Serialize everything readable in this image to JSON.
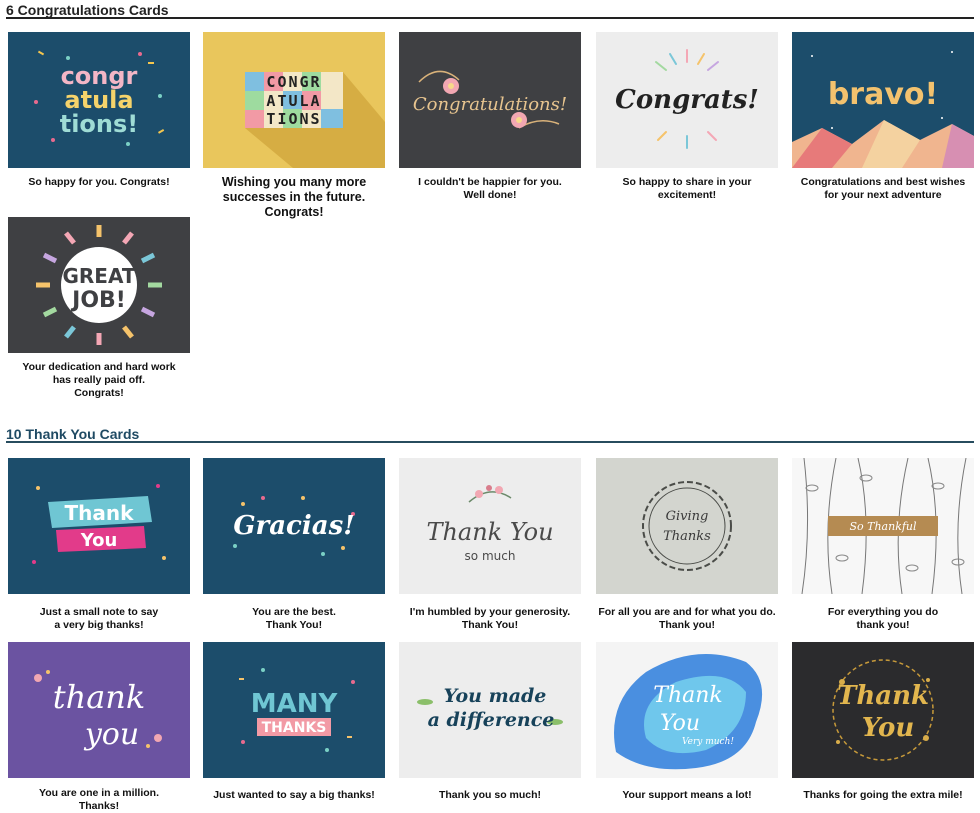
{
  "sections": [
    {
      "title": "6 Congratulations Cards"
    },
    {
      "title": "10 Thank You Cards"
    }
  ],
  "colors": {
    "rule": "#274c5e",
    "title": "#1f4a63",
    "navy": "#1c4d6b",
    "charcoal": "#3f4043",
    "yellow": "#e9c65c",
    "light": "#ededed",
    "sage": "#d3d5cf",
    "purple": "#6b53a1"
  },
  "cards": [
    {
      "art": [
        "congr",
        "atula",
        "tions!"
      ],
      "caption": [
        "So happy for you. Congrats!"
      ]
    },
    {
      "art": [
        "CONGR",
        "ATULA",
        "TIONS"
      ],
      "caption": [
        "Wishing you many more",
        "successes in the future.",
        "Congrats!"
      ]
    },
    {
      "art": [
        "Congratulations!"
      ],
      "caption": [
        "I couldn't be happier for you.",
        "Well done!"
      ]
    },
    {
      "art": [
        "Congrats!"
      ],
      "caption": [
        "So happy to share in your excitement!"
      ]
    },
    {
      "art": [
        "bravo!"
      ],
      "caption": [
        "Congratulations and best wishes",
        "for your next adventure"
      ]
    },
    {
      "art": [
        "GREAT",
        "JOB!"
      ],
      "caption": [
        "Your dedication and hard work",
        "has really paid off.",
        "Congrats!"
      ]
    },
    {
      "art": [
        "Thank",
        "You"
      ],
      "caption": [
        "Just a small note to say",
        "a very big thanks!"
      ]
    },
    {
      "art": [
        "Gracias!"
      ],
      "caption": [
        "You are the best.",
        "Thank You!"
      ]
    },
    {
      "art": [
        "Thank You",
        "so much"
      ],
      "caption": [
        "I'm humbled by your generosity.",
        "Thank You!"
      ]
    },
    {
      "art": [
        "Giving",
        "Thanks"
      ],
      "caption": [
        "For all you are and for what you do.",
        "Thank you!"
      ]
    },
    {
      "art": [
        "So Thankful"
      ],
      "caption": [
        "For everything you do",
        "thank you!"
      ]
    },
    {
      "art": [
        "thank",
        "you"
      ],
      "caption": [
        "You are one in a million.",
        "Thanks!"
      ]
    },
    {
      "art": [
        "MANY",
        "THANKS"
      ],
      "caption": [
        "Just wanted to say a big thanks!"
      ]
    },
    {
      "art": [
        "You made",
        "a difference"
      ],
      "caption": [
        "Thank you so much!"
      ]
    },
    {
      "art": [
        "Thank",
        "You",
        "Very much!"
      ],
      "caption": [
        "Your support means a lot!"
      ]
    },
    {
      "art": [
        "Thank",
        "You"
      ],
      "caption": [
        "Thanks for going the extra mile!"
      ]
    }
  ]
}
